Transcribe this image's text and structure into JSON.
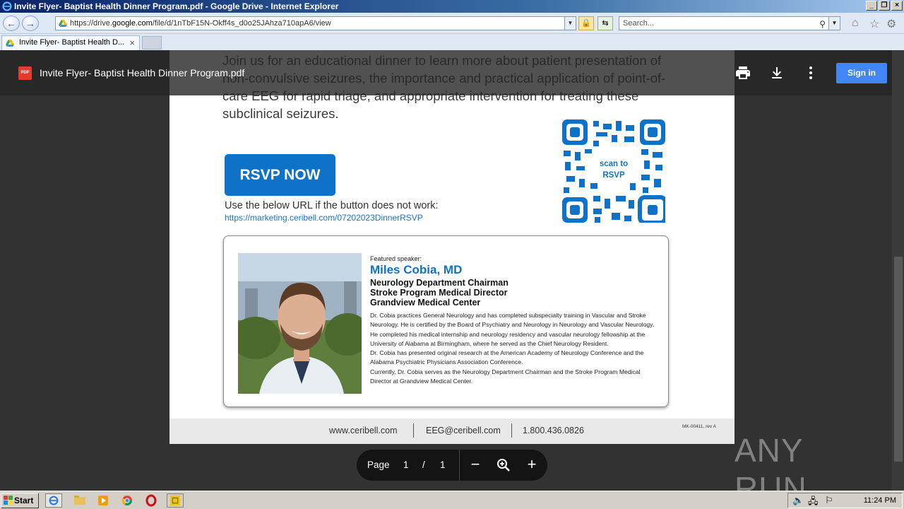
{
  "window": {
    "title": "Invite Flyer- Baptist Health Dinner Program.pdf - Google Drive - Internet Explorer"
  },
  "addressbar": {
    "url_prefix": "https://drive.",
    "url_host": "google.com",
    "url_path": "/file/d/1nTbF15N-Okff4s_d0o25JAhza710apA6/view",
    "search_placeholder": "Search..."
  },
  "tab": {
    "label": "Invite Flyer- Baptist Health D..."
  },
  "viewer": {
    "file_title": "Invite Flyer- Baptist Health Dinner Program.pdf",
    "badge": "PDF",
    "signin_label": "Sign in",
    "page_label": "Page",
    "page_current": "1",
    "page_sep": "/",
    "page_total": "1"
  },
  "flyer": {
    "intro": "Join us for an educational dinner to learn more about patient presentation of non-convulsive seizures, the importance and practical application of point-of-care EEG for rapid triage, and appropriate intervention for treating these subclinical seizures.",
    "rsvp_button": "RSVP NOW",
    "rsvp_note": "Use the below URL if the button does not work:",
    "rsvp_url": "https://marketing.ceribell.com/07202023DinnerRSVP",
    "qr_label_1": "scan to",
    "qr_label_2": "RSVP",
    "speaker_label": "Featured speaker:",
    "speaker_name": "Miles Cobia, MD",
    "speaker_title_1": "Neurology Department Chairman",
    "speaker_title_2": "Stroke Program Medical Director",
    "speaker_title_3": "Grandview Medical Center",
    "bio_1": "Dr. Cobia practices General Neurology and has completed subspecialty training in Vascular and Stroke Neurology. He is certified by the Board of Psychiatry and Neurology in Neurology and Vascular Neurology.",
    "bio_2": "He completed his medical internship and neurology residency and vascular neurology fellowship at the University of Alabama at Birmingham, where he served as the Chief Neurology Resident.",
    "bio_3": "Dr. Cobia has presented original research at the American Academy of Neurology Conference and the Alabama Psychiatric Physicians Association Conference.",
    "bio_4": "Currently, Dr. Cobia serves as the Neurology Department Chairman and the Stroke Program Medical Director at Grandview Medical Center.",
    "footer_web": "www.ceribell.com",
    "footer_email": "EEG@ceribell.com",
    "footer_phone": "1.800.436.0826",
    "footer_code": "MK-00411, rev A"
  },
  "watermark": "ANY RUN",
  "taskbar": {
    "start": "Start",
    "clock": "11:24 PM"
  },
  "colors": {
    "brand_blue": "#0e73c8",
    "signin_blue": "#4285f4",
    "pdf_red": "#e33b2e"
  }
}
